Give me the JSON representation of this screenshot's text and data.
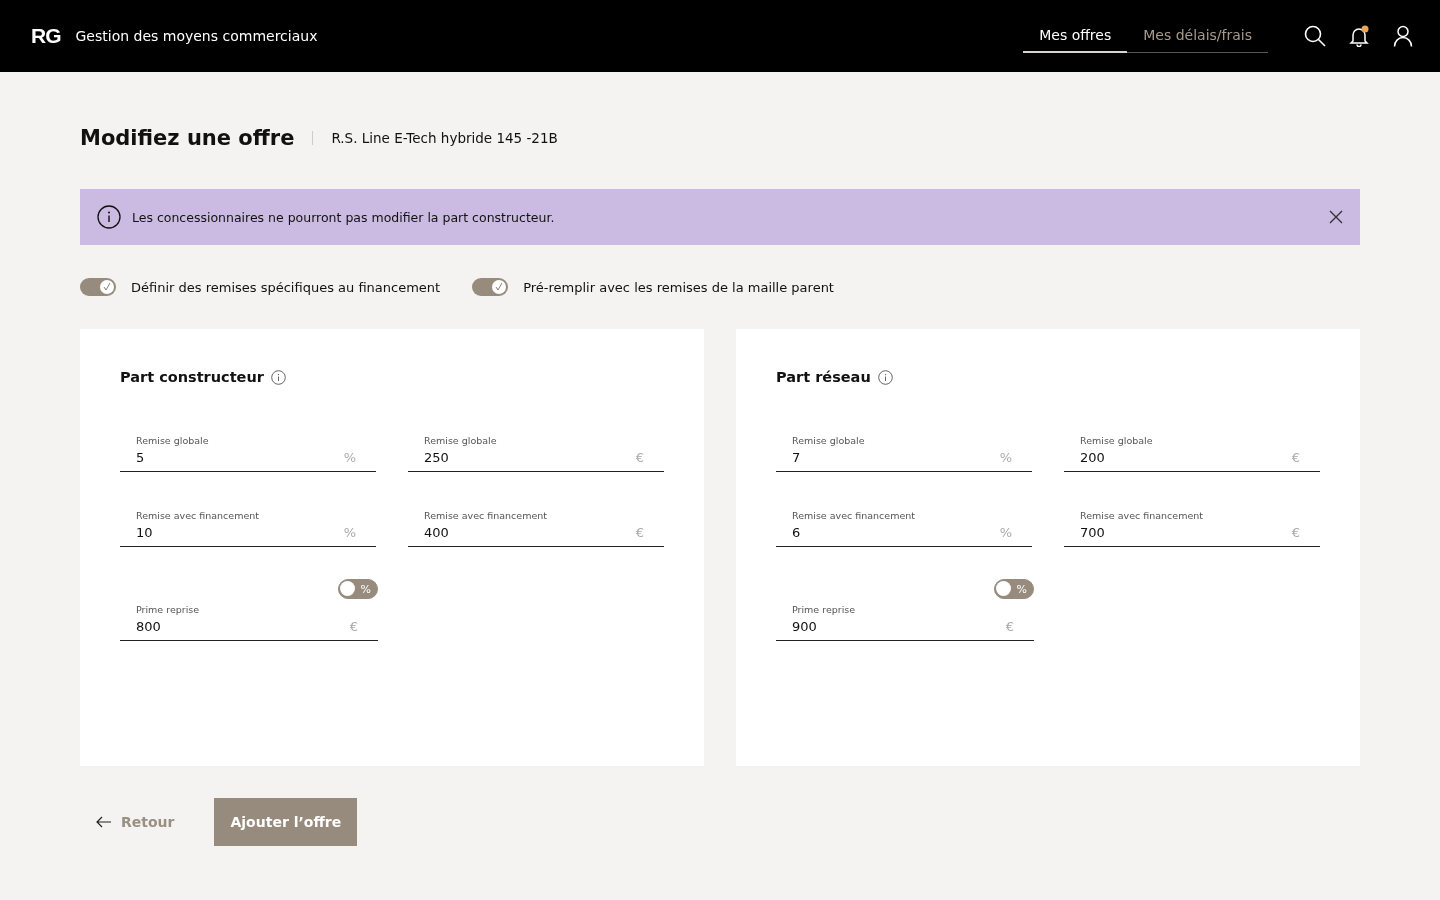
{
  "header": {
    "logo": "RG",
    "app_title": "Gestion des moyens commerciaux",
    "tabs": [
      {
        "label": "Mes offres",
        "selected": true
      },
      {
        "label": "Mes délais/frais",
        "selected": false
      }
    ],
    "notification": true
  },
  "page": {
    "title": "Modifiez une offre",
    "subtitle": "R.S. Line E-Tech hybride 145 -21B"
  },
  "alert": {
    "text": "Les concessionnaires ne pourront pas modifier la part constructeur."
  },
  "options": [
    {
      "label": "Définir des remises spécifiques au financement",
      "on": true
    },
    {
      "label": "Pré-remplir avec les remises de la maille parent",
      "on": true
    }
  ],
  "panels": [
    {
      "title": "Part constructeur",
      "fields": [
        {
          "label": "Remise globale",
          "value": "5",
          "unit": "%"
        },
        {
          "label": "Remise globale",
          "value": "250",
          "unit": "€"
        },
        {
          "label": "Remise avec financement",
          "value": "10",
          "unit": "%"
        },
        {
          "label": "Remise avec financement",
          "value": "400",
          "unit": "€"
        }
      ],
      "prime": {
        "switch_label": "%",
        "on": false,
        "label": "Prime reprise",
        "value": "800",
        "unit": "€"
      }
    },
    {
      "title": "Part réseau",
      "fields": [
        {
          "label": "Remise globale",
          "value": "7",
          "unit": "%"
        },
        {
          "label": "Remise globale",
          "value": "200",
          "unit": "€"
        },
        {
          "label": "Remise avec financement",
          "value": "6",
          "unit": "%"
        },
        {
          "label": "Remise avec financement",
          "value": "700",
          "unit": "€"
        }
      ],
      "prime": {
        "switch_label": "%",
        "on": false,
        "label": "Prime reprise",
        "value": "900",
        "unit": "€"
      }
    }
  ],
  "footer": {
    "back": "Retour",
    "submit": "Ajouter l’offre"
  }
}
